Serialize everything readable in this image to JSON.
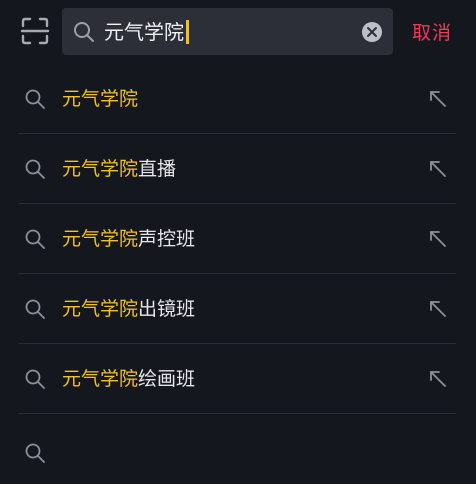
{
  "search": {
    "query": "元气学院"
  },
  "actions": {
    "cancel_label": "取消"
  },
  "suggestions": [
    {
      "highlight": "元气学院",
      "rest": ""
    },
    {
      "highlight": "元气学院",
      "rest": "直播"
    },
    {
      "highlight": "元气学院",
      "rest": "声控班"
    },
    {
      "highlight": "元气学院",
      "rest": "出镜班"
    },
    {
      "highlight": "元气学院",
      "rest": "绘画班"
    }
  ],
  "icons": {
    "scan": "scan-icon",
    "search": "search-icon",
    "clear": "clear-icon",
    "fill_query": "arrow-up-left-icon"
  },
  "colors": {
    "background": "#15171f",
    "search_box": "#2d2f38",
    "highlight": "#f2c12e",
    "cancel": "#ef3b55",
    "caret": "#f3c020"
  }
}
